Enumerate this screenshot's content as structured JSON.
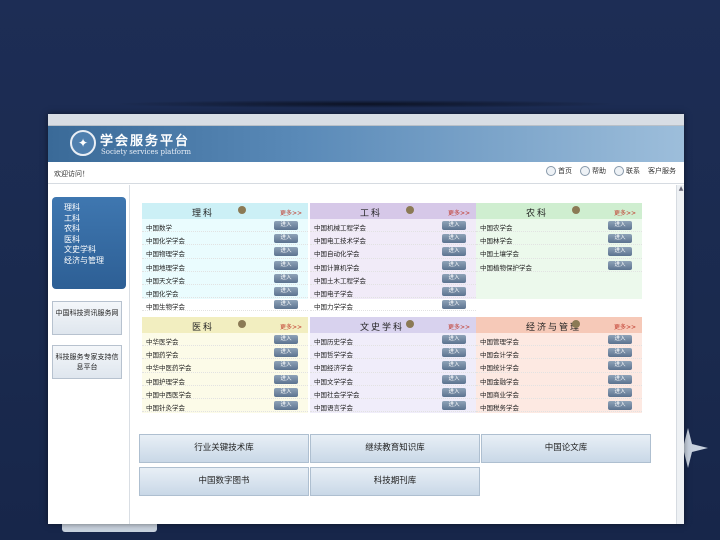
{
  "header": {
    "title": "学会服务平台",
    "subtitle": "Society services platform"
  },
  "toolbar": {
    "welcome": "欢迎访问！",
    "links": [
      "首页",
      "帮助",
      "联系",
      "客户服务"
    ]
  },
  "sidebar": {
    "nav_items": [
      "理科",
      "工科",
      "农科",
      "医科",
      "文史学科",
      "经济与管理"
    ],
    "box1": "中国科技资讯服务网",
    "box2": "科技服务专家支持信息平台"
  },
  "panels": [
    {
      "name": "理科",
      "more": "更多>>",
      "bg": "#ccf0f6",
      "body": "#eafcfe",
      "rows": [
        "中国数学",
        "中国化学学会",
        "中国物理学会",
        "中国地理学会",
        "中国天文学会",
        "中国化学会",
        "中国生物学会"
      ]
    },
    {
      "name": "工科",
      "more": "更多>>",
      "bg": "#d6c8e8",
      "body": "#f1ebf8",
      "rows": [
        "中国机械工程学会",
        "中国电工技术学会",
        "中国自动化学会",
        "中国计算机学会",
        "中国土木工程学会",
        "中国电子学会",
        "中国力学学会"
      ]
    },
    {
      "name": "农科",
      "more": "更多>>",
      "bg": "#cfeed0",
      "body": "#ecf9ec",
      "rows": [
        "中国农学会",
        "中国林学会",
        "中国土壤学会",
        "中国植物保护学会"
      ]
    },
    {
      "name": "医科",
      "more": "更多>>",
      "bg": "#f2eec0",
      "body": "#fcfbe8",
      "rows": [
        "中华医学会",
        "中国药学会",
        "中华中医药学会",
        "中国护理学会",
        "中国中西医学会",
        "中国针灸学会"
      ]
    },
    {
      "name": "文史学科",
      "more": "更多>>",
      "bg": "#d8d2ee",
      "body": "#f0edfa",
      "rows": [
        "中国历史学会",
        "中国哲学学会",
        "中国经济学会",
        "中国文学学会",
        "中国社会学学会",
        "中国语言学会"
      ]
    },
    {
      "name": "经济与管理",
      "more": "更多>>",
      "bg": "#f6c9b8",
      "body": "#fde9e2",
      "rows": [
        "中国管理学会",
        "中国会计学会",
        "中国统计学会",
        "中国金融学会",
        "中国商业学会",
        "中国税务学会"
      ]
    }
  ],
  "row_button": "进入",
  "bottom_links": [
    "行业关键技术库",
    "继续教育知识库",
    "中国论文库",
    "中国数字图书",
    "科技期刊库"
  ]
}
